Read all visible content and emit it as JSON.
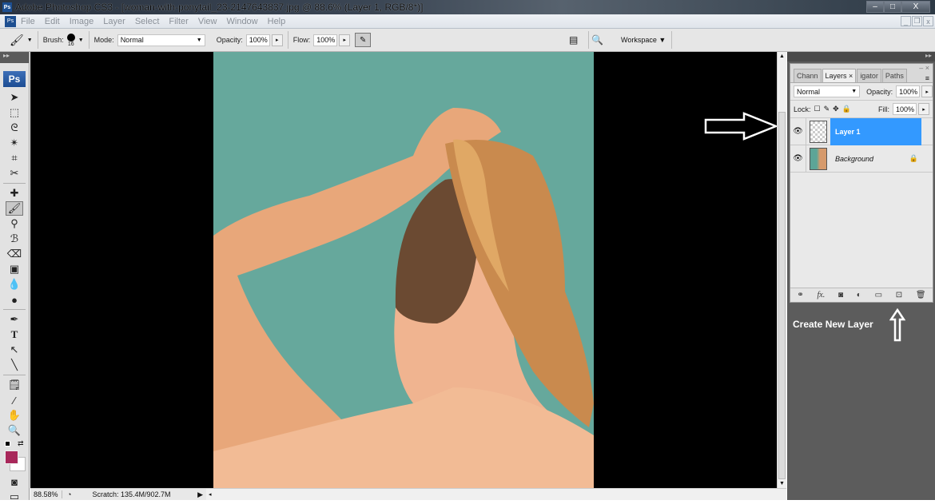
{
  "window": {
    "title": "Adobe Photoshop CS3 - [woman-with-ponytail_23-2147643837.jpg @ 88.6% (Layer 1, RGB/8*)]",
    "minimize": "–",
    "maximize": "□",
    "close": "X"
  },
  "menu": {
    "items": [
      "File",
      "Edit",
      "Image",
      "Layer",
      "Select",
      "Filter",
      "View",
      "Window",
      "Help"
    ]
  },
  "options": {
    "brush_label": "Brush:",
    "brush_size": "16",
    "mode_label": "Mode:",
    "mode_value": "Normal",
    "opacity_label": "Opacity:",
    "opacity_value": "100%",
    "flow_label": "Flow:",
    "flow_value": "100%",
    "workspace_label": "Workspace ▼"
  },
  "toolbox": {
    "logo": "Ps",
    "tools": [
      "move",
      "marquee",
      "lasso",
      "magic-wand",
      "crop",
      "slice",
      "healing",
      "brush",
      "stamp",
      "history-brush",
      "eraser",
      "gradient",
      "blur",
      "dodge",
      "pen",
      "type",
      "path-select",
      "line",
      "notes",
      "eyedropper",
      "hand",
      "zoom"
    ],
    "foreground_color": "#a8285a",
    "background_color": "#ffffff"
  },
  "status": {
    "zoom": "88.58%",
    "scratch": "Scratch: 135.4M/902.7M"
  },
  "layers_panel": {
    "tabs": [
      "Chann",
      "Layers ×",
      "igator",
      "Paths"
    ],
    "active_tab": 1,
    "blend_mode": "Normal",
    "opacity_label": "Opacity:",
    "opacity_value": "100%",
    "lock_label": "Lock:",
    "fill_label": "Fill:",
    "fill_value": "100%",
    "layers": [
      {
        "name": "Layer 1",
        "selected": true,
        "visible": true
      },
      {
        "name": "Background",
        "selected": false,
        "visible": true,
        "locked": true
      }
    ],
    "footer_icons": [
      "link",
      "fx",
      "mask",
      "adjustment",
      "group",
      "new-layer",
      "delete"
    ]
  },
  "annotation": {
    "text": "Create New Layer"
  },
  "colors": {
    "selection": "#3399ff",
    "canvas_bg": "#66a89c"
  }
}
